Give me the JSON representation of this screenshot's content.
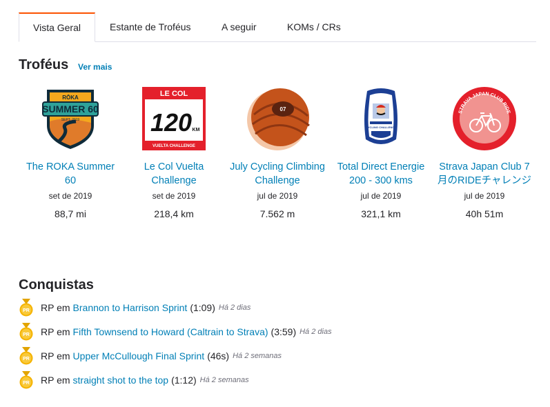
{
  "tabs": [
    {
      "label": "Vista Geral"
    },
    {
      "label": "Estante de Troféus"
    },
    {
      "label": "A seguir"
    },
    {
      "label": "KOMs / CRs"
    }
  ],
  "trophies_section": {
    "title": "Troféus",
    "see_more": "Ver mais",
    "items": [
      {
        "name": "The ROKA Summer 60",
        "date": "set de 2019",
        "value": "88,7 mi",
        "badge_text_top": "RŌKA",
        "badge_text_main": "SUMMER 60",
        "badge_text_sub": "SEPT. 2019"
      },
      {
        "name": "Le Col Vuelta Challenge",
        "date": "set de 2019",
        "value": "218,4 km",
        "badge_text_top": "LE COL",
        "badge_text_main": "120",
        "badge_text_unit": "KM",
        "badge_text_sub": "VUELTA CHALLENGE"
      },
      {
        "name": "July Cycling Climbing Challenge",
        "date": "jul de 2019",
        "value": "7.562 m",
        "badge_text_main": "07"
      },
      {
        "name": "Total Direct Energie 200 - 300 kms",
        "date": "jul de 2019",
        "value": "321,1 km",
        "badge_text_sub": "CYCLING CHALLENGE"
      },
      {
        "name": "Strava Japan Club 7月のRIDEチャレンジ",
        "date": "jul de 2019",
        "value": "40h 51m",
        "badge_text_top": "STRAVA JAPAN CLUB RIDE"
      }
    ]
  },
  "achievements_section": {
    "title": "Conquistas",
    "items": [
      {
        "prefix": "RP em",
        "segment": "Brannon to Harrison Sprint",
        "time": "(1:09)",
        "when": "Há 2 dias",
        "medal_label": "PR"
      },
      {
        "prefix": "RP em",
        "segment": "Fifth Townsend to Howard (Caltrain to Strava)",
        "time": "(3:59)",
        "when": "Há 2 dias",
        "medal_label": "PR"
      },
      {
        "prefix": "RP em",
        "segment": "Upper McCullough Final Sprint",
        "time": "(46s)",
        "when": "Há 2 semanas",
        "medal_label": "PR"
      },
      {
        "prefix": "RP em",
        "segment": "straight shot to the top",
        "time": "(1:12)",
        "when": "Há 2 semanas",
        "medal_label": "PR"
      }
    ]
  },
  "colors": {
    "accent": "#fc5200",
    "link": "#007fb6",
    "gold": "#f5b301"
  }
}
